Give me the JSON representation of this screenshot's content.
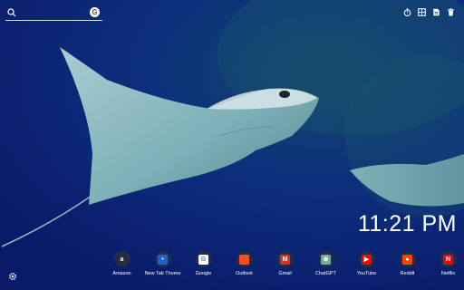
{
  "search": {
    "placeholder": "",
    "engine_icon": "google-icon",
    "engine_glyph": "G"
  },
  "toolbar": {
    "icons": [
      "timer-icon",
      "dashboard-icon",
      "document-icon",
      "trash-icon"
    ]
  },
  "clock": {
    "time": "11:21 PM"
  },
  "shortcuts": [
    {
      "label": "Amazon",
      "icon": "amazon-icon",
      "glyph": "a",
      "color": "#232f3e"
    },
    {
      "label": "New Tab Theme",
      "icon": "new-tab-theme-icon",
      "glyph": "•",
      "color": "#1f63c8"
    },
    {
      "label": "Google",
      "icon": "google-icon",
      "glyph": "G",
      "color": "#ffffff"
    },
    {
      "label": "Outlook",
      "icon": "outlook-icon",
      "glyph": "",
      "color": "#f25022"
    },
    {
      "label": "Gmail",
      "icon": "gmail-icon",
      "glyph": "M",
      "color": "#d93025"
    },
    {
      "label": "ChatGPT",
      "icon": "chatgpt-icon",
      "glyph": "⊛",
      "color": "#74aa9c"
    },
    {
      "label": "YouTube",
      "icon": "youtube-icon",
      "glyph": "▶",
      "color": "#ff0000"
    },
    {
      "label": "Reddit",
      "icon": "reddit-icon",
      "glyph": "●",
      "color": "#ff4500"
    },
    {
      "label": "Netflix",
      "icon": "netflix-icon",
      "glyph": "N",
      "color": "#e50914"
    }
  ],
  "settings": {
    "icon": "gear-icon"
  }
}
